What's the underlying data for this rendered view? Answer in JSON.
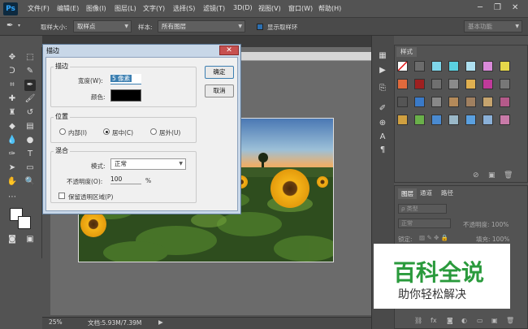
{
  "app": {
    "logo": "Ps"
  },
  "menu": [
    "文件(F)",
    "编辑(E)",
    "图像(I)",
    "图层(L)",
    "文字(Y)",
    "选择(S)",
    "滤镜(T)",
    "3D(D)",
    "视图(V)",
    "窗口(W)",
    "帮助(H)"
  ],
  "window_controls": {
    "minimize": "─",
    "restore": "❐",
    "close": "✕"
  },
  "options": {
    "sample_size_label": "取样大小:",
    "sample_size_value": "取样点",
    "sample_label": "样本:",
    "sample_value": "所有图层",
    "show_ring_label": "显示取样环",
    "workspace": "基本功能"
  },
  "dialog": {
    "title": "描边",
    "close": "✕",
    "stroke_group": "描边",
    "width_label": "宽度(W):",
    "width_value": "5 像素",
    "color_label": "颜色:",
    "color_value": "#000000",
    "ok": "确定",
    "cancel": "取消",
    "position_group": "位置",
    "position_inside": "内部(I)",
    "position_center": "居中(C)",
    "position_outside": "居外(U)",
    "blend_group": "混合",
    "mode_label": "模式:",
    "mode_value": "正常",
    "opacity_label": "不透明度(O):",
    "opacity_value": "100",
    "opacity_unit": "%",
    "preserve_label": "保留透明区域(P)"
  },
  "status": {
    "zoom": "25%",
    "doc": "文档:5.93M/7.39M"
  },
  "styles_panel": {
    "tab": "样式"
  },
  "layers_panel": {
    "tabs": [
      "图层",
      "通道",
      "路径"
    ],
    "kind": "ρ 类型",
    "blend": "正常",
    "opacity": "不透明度: 100%",
    "lock": "锁定:",
    "fill": "填充: 100%"
  },
  "watermark": {
    "title": "百科全说",
    "subtitle": "助你轻松解决"
  },
  "colors": {
    "accent": "#3c7fb1",
    "watermark_green": "#2a9a3c"
  }
}
